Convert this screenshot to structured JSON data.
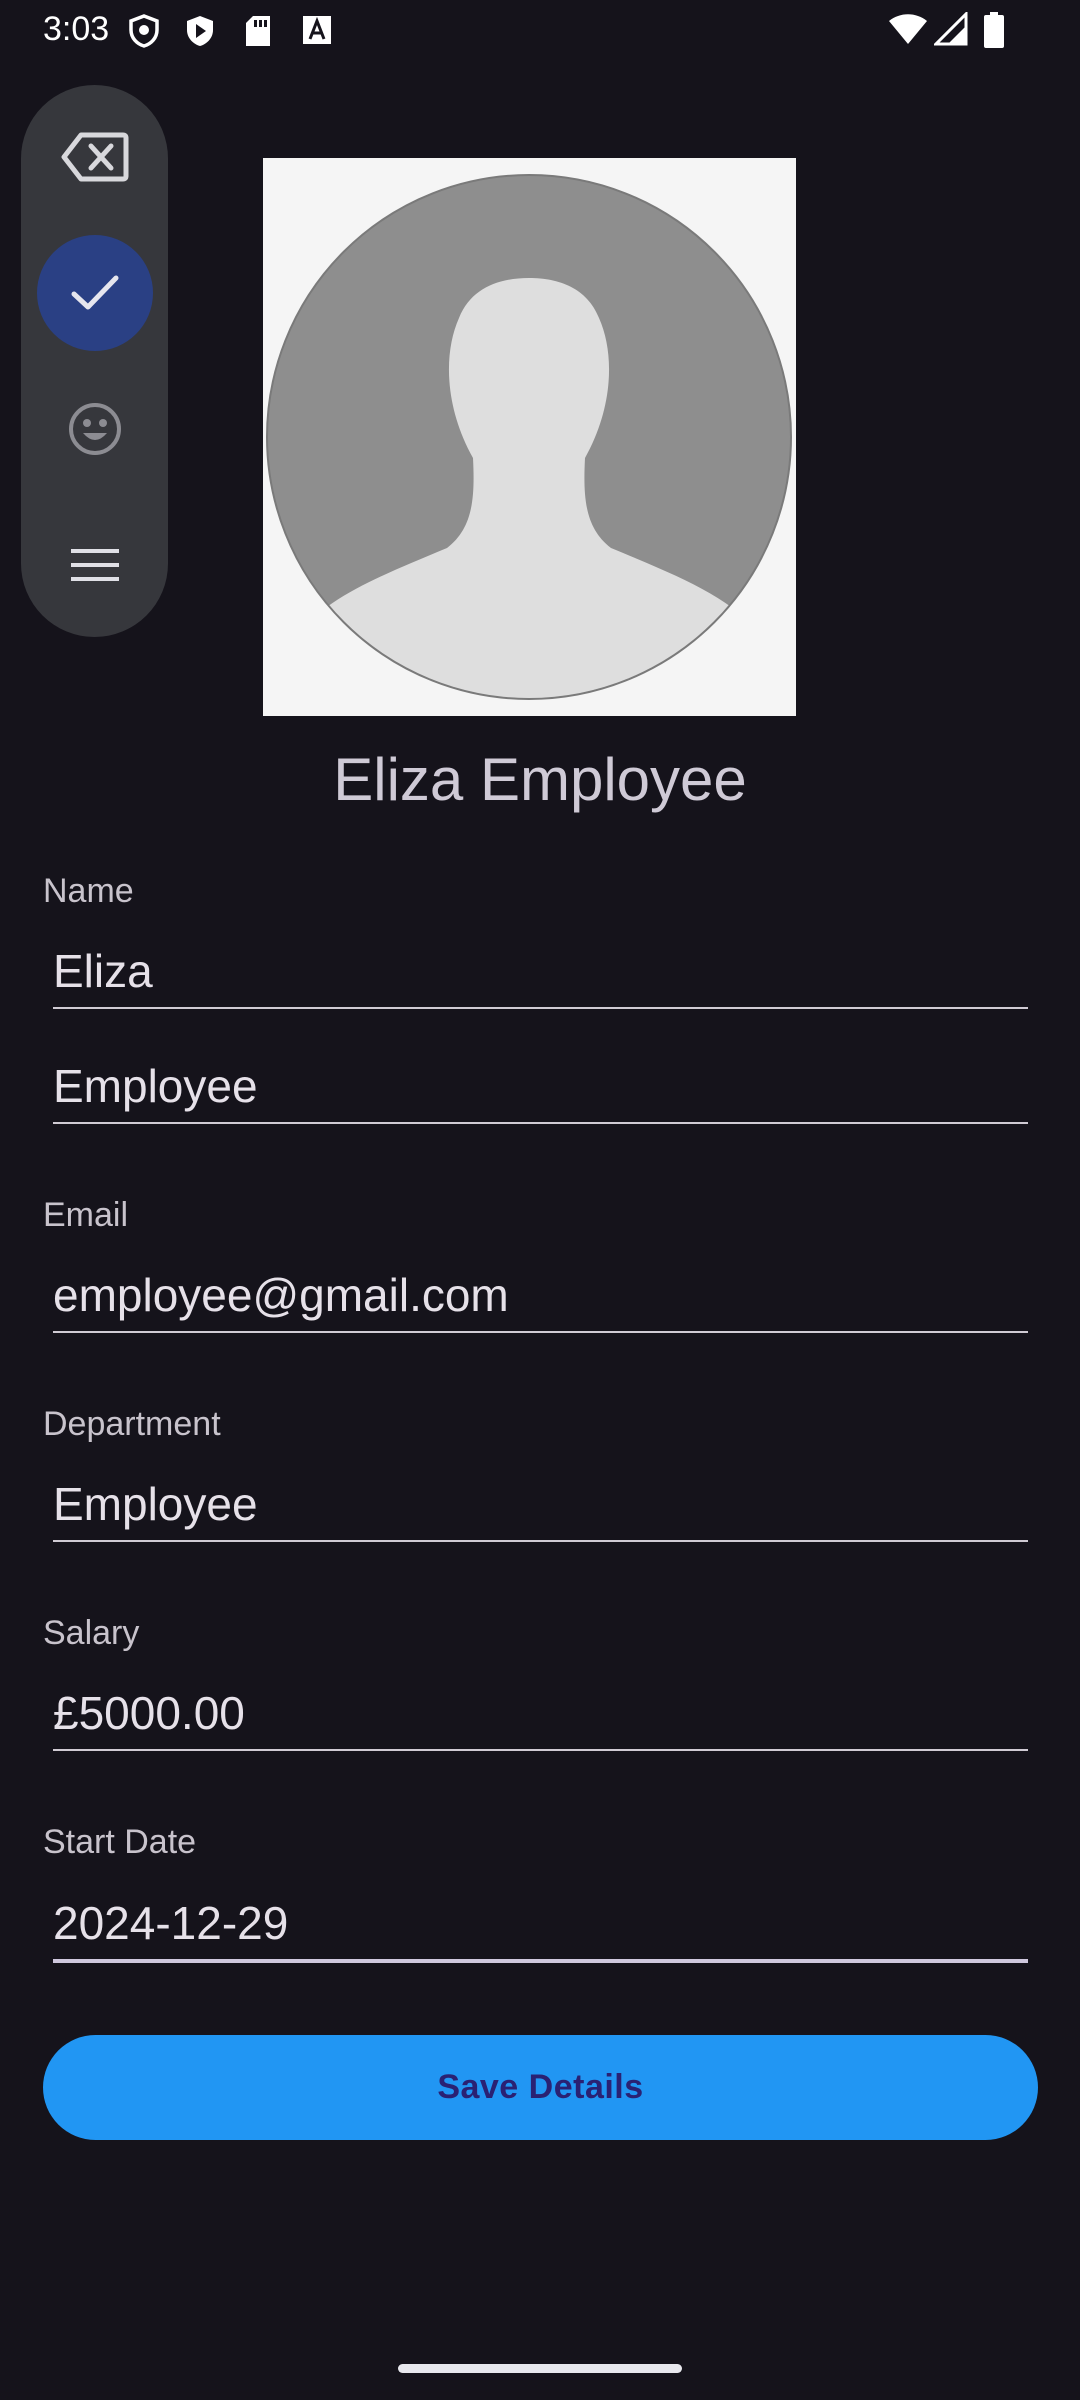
{
  "status_bar": {
    "time": "3:03",
    "icons": [
      "shield-icon",
      "play-store-icon",
      "sd-card-icon",
      "font-a-icon",
      "wifi-icon",
      "cell-signal-icon",
      "battery-icon"
    ]
  },
  "toolbar": {
    "items": [
      "backspace-icon",
      "check-icon",
      "emoji-icon",
      "menu-icon"
    ],
    "active_index": 1
  },
  "profile": {
    "full_name": "Eliza Employee"
  },
  "form": {
    "name_label": "Name",
    "first_name": "Eliza",
    "last_name": "Employee",
    "email_label": "Email",
    "email": "employee@gmail.com",
    "department_label": "Department",
    "department": "Employee",
    "salary_label": "Salary",
    "salary": "£5000.00",
    "start_date_label": "Start Date",
    "start_date": "2024-12-29",
    "save_label": "Save Details"
  },
  "colors": {
    "background": "#15131b",
    "primary": "#2196f3",
    "active_toolbar_button": "#2a4084"
  }
}
